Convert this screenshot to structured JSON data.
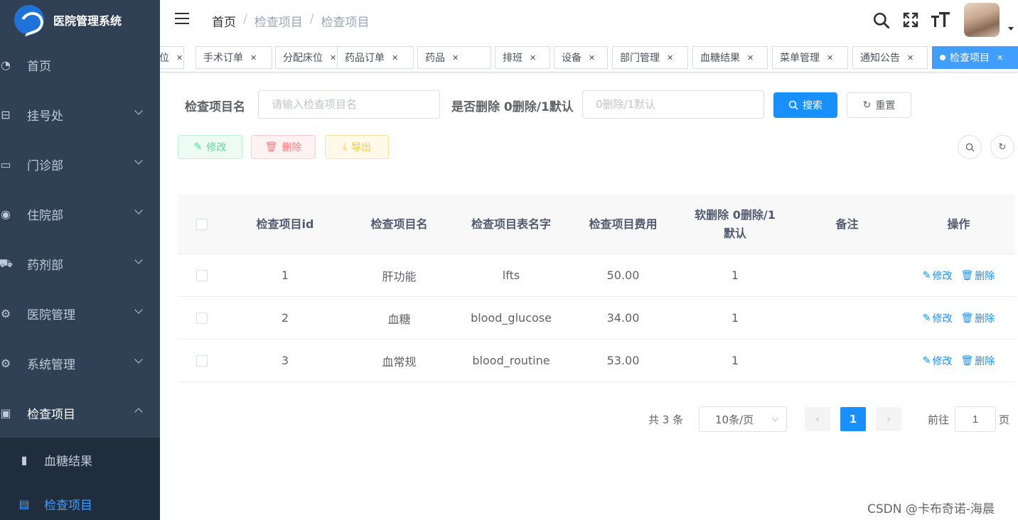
{
  "app": {
    "title": "医院管理系统"
  },
  "sidebar": {
    "items": [
      {
        "label": "首页",
        "icon": "dashboard-icon",
        "glyph": "◔",
        "expandable": false
      },
      {
        "label": "挂号处",
        "icon": "register-icon",
        "glyph": "⊟",
        "expandable": true
      },
      {
        "label": "门诊部",
        "icon": "monitor-icon",
        "glyph": "▭",
        "expandable": true
      },
      {
        "label": "住院部",
        "icon": "chrome-icon",
        "glyph": "◉",
        "expandable": true
      },
      {
        "label": "药剂部",
        "icon": "cart-icon",
        "glyph": "⛟",
        "expandable": true
      },
      {
        "label": "医院管理",
        "icon": "gear-icon",
        "glyph": "⚙",
        "expandable": true
      },
      {
        "label": "系统管理",
        "icon": "gear-icon",
        "glyph": "⚙",
        "expandable": true
      },
      {
        "label": "检查项目",
        "icon": "briefcase-icon",
        "glyph": "▣",
        "expandable": true,
        "open": true
      }
    ],
    "submenu": [
      {
        "label": "血糖结果",
        "icon": "bar-chart-icon",
        "glyph": "▮",
        "active": false
      },
      {
        "label": "检查项目",
        "icon": "document-icon",
        "glyph": "▤",
        "active": true
      }
    ]
  },
  "navbar": {
    "breadcrumb": [
      "首页",
      "检查项目",
      "检查项目"
    ],
    "tools": [
      "search-icon",
      "fullscreen-icon",
      "font-size-icon"
    ]
  },
  "tags": [
    {
      "label": "位",
      "active": false
    },
    {
      "label": "手术订单",
      "active": false
    },
    {
      "label": "分配床位",
      "active": false
    },
    {
      "label": "药品订单",
      "active": false
    },
    {
      "label": "药品",
      "active": false
    },
    {
      "label": "排班",
      "active": false
    },
    {
      "label": "设备",
      "active": false
    },
    {
      "label": "部门管理",
      "active": false
    },
    {
      "label": "血糖结果",
      "active": false
    },
    {
      "label": "菜单管理",
      "active": false
    },
    {
      "label": "通知公告",
      "active": false
    },
    {
      "label": "检查项目",
      "active": true
    }
  ],
  "search": {
    "name_label": "检查项目名",
    "name_placeholder": "请输入检查项目名",
    "deleted_label": "是否删除 0删除/1默认",
    "deleted_placeholder": "0删除/1默认",
    "search_button": "搜索",
    "reset_button": "重置"
  },
  "toolbar": {
    "edit": "修改",
    "delete": "删除",
    "export": "导出"
  },
  "table": {
    "headers": [
      "检查项目id",
      "检查项目名",
      "检查项目表名字",
      "检查项目费用",
      "软删除 0删除/1默认",
      "备注",
      "操作"
    ],
    "rows": [
      {
        "id": "1",
        "name": "肝功能",
        "table_name": "lfts",
        "fee": "50.00",
        "deleted": "1",
        "remark": ""
      },
      {
        "id": "2",
        "name": "血糖",
        "table_name": "blood_glucose",
        "fee": "34.00",
        "deleted": "1",
        "remark": ""
      },
      {
        "id": "3",
        "name": "血常规",
        "table_name": "blood_routine",
        "fee": "53.00",
        "deleted": "1",
        "remark": ""
      }
    ],
    "edit_label": "修改",
    "delete_label": "删除"
  },
  "pagination": {
    "total_text": "共 3 条",
    "page_size": "10条/页",
    "current_page": "1",
    "goto_label": "前往",
    "goto_value": "1",
    "page_suffix": "页"
  },
  "watermark": "CSDN @卡布奇诺-海晨",
  "colors": {
    "primary": "#1890ff",
    "sidebar_bg": "#304156",
    "sidebar_text": "#bfcbd9"
  }
}
